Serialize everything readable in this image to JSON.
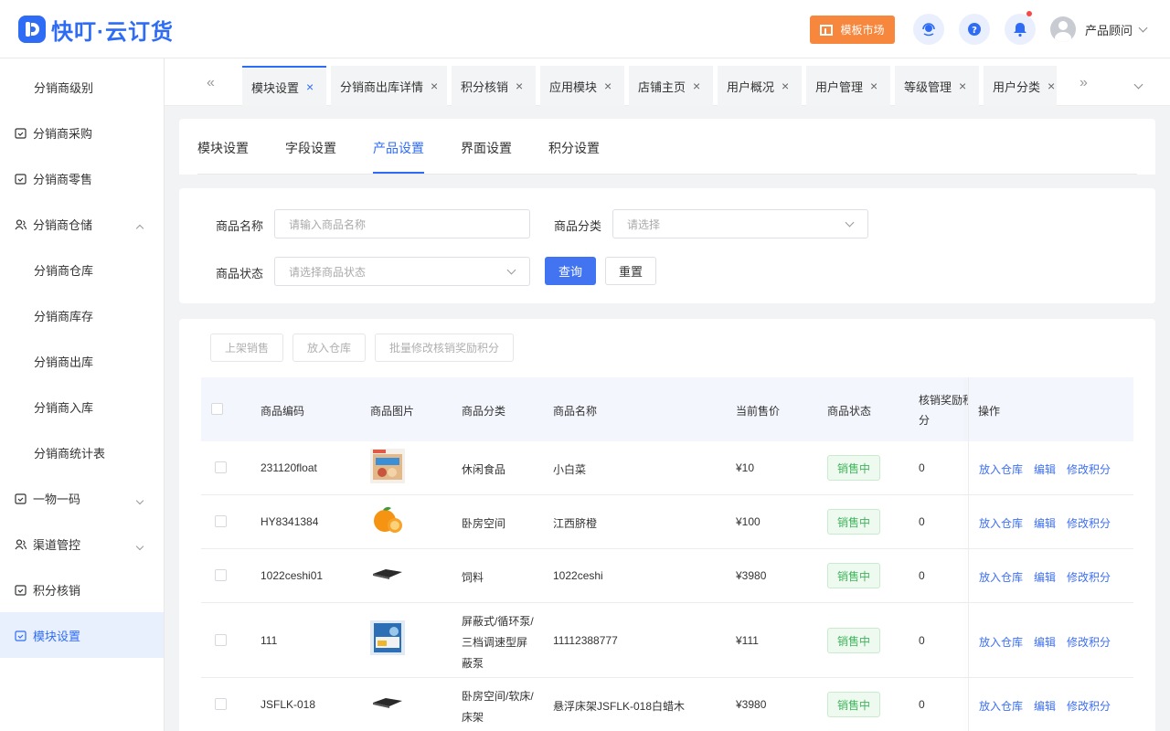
{
  "header": {
    "logo_text": "快叮·云订货",
    "market_label": "模板市场",
    "user_name": "产品顾问"
  },
  "sidebar": {
    "items": [
      {
        "label": "分销商级别",
        "level": "sub"
      },
      {
        "label": "分销商采购",
        "level": "top",
        "icon": "calendar-icon"
      },
      {
        "label": "分销商零售",
        "level": "top",
        "icon": "calendar-icon"
      },
      {
        "label": "分销商仓储",
        "level": "top",
        "icon": "users-icon",
        "expanded": true
      },
      {
        "label": "分销商仓库",
        "level": "sub"
      },
      {
        "label": "分销商库存",
        "level": "sub"
      },
      {
        "label": "分销商出库",
        "level": "sub"
      },
      {
        "label": "分销商入库",
        "level": "sub"
      },
      {
        "label": "分销商统计表",
        "level": "sub"
      },
      {
        "label": "一物一码",
        "level": "top",
        "icon": "calendar-icon",
        "collapsible": true
      },
      {
        "label": "渠道管控",
        "level": "top",
        "icon": "users-icon",
        "collapsible": true
      },
      {
        "label": "积分核销",
        "level": "top",
        "icon": "calendar-icon"
      },
      {
        "label": "模块设置",
        "level": "top",
        "icon": "calendar-icon",
        "active": true
      }
    ]
  },
  "tabs": {
    "prev_symbol": "«",
    "next_symbol": "»",
    "items": [
      {
        "label": "模块设置",
        "active": true
      },
      {
        "label": "分销商出库详情"
      },
      {
        "label": "积分核销"
      },
      {
        "label": "应用模块"
      },
      {
        "label": "店铺主页"
      },
      {
        "label": "用户概况"
      },
      {
        "label": "用户管理"
      },
      {
        "label": "等级管理"
      },
      {
        "label": "用户分类"
      }
    ],
    "close_symbol": "×"
  },
  "subtabs": [
    {
      "label": "模块设置"
    },
    {
      "label": "字段设置"
    },
    {
      "label": "产品设置",
      "active": true
    },
    {
      "label": "界面设置"
    },
    {
      "label": "积分设置"
    }
  ],
  "filters": {
    "name_label": "商品名称",
    "name_placeholder": "请输入商品名称",
    "category_label": "商品分类",
    "category_placeholder": "请选择",
    "status_label": "商品状态",
    "status_placeholder": "请选择商品状态",
    "query_label": "查询",
    "reset_label": "重置"
  },
  "actions": {
    "on_sale": "上架销售",
    "to_warehouse": "放入仓库",
    "batch_points": "批量修改核销奖励积分"
  },
  "table": {
    "headers": [
      "商品编码",
      "商品图片",
      "商品分类",
      "商品名称",
      "当前售价",
      "商品状态",
      "核销奖励积分",
      "操作"
    ],
    "header_points_line1": "核销奖励积",
    "header_points_line2": "分",
    "rows": [
      {
        "code": "231120float",
        "image": "snack-bag-image",
        "category": [
          "休闲食品"
        ],
        "name": "小白菜",
        "price": "¥10",
        "status": "销售中",
        "points": "0"
      },
      {
        "code": "HY8341384",
        "image": "orange-image",
        "category": [
          "卧房空间"
        ],
        "name": "江西脐橙",
        "price": "¥100",
        "status": "销售中",
        "points": "0"
      },
      {
        "code": "1022ceshi01",
        "image": "black-board-image",
        "category": [
          "饲料"
        ],
        "name": "1022ceshi",
        "price": "¥3980",
        "status": "销售中",
        "points": "0"
      },
      {
        "code": "111",
        "image": "product-box-image",
        "category": [
          "屏蔽式/循环泵/",
          "三档调速型屏",
          "蔽泵"
        ],
        "name": "11112388777",
        "price": "¥111",
        "status": "销售中",
        "points": "0"
      },
      {
        "code": "JSFLK-018",
        "image": "black-board-image",
        "category": [
          "卧房空间/软床/",
          "床架"
        ],
        "name": "悬浮床架JSFLK-018白蜡木",
        "price": "¥3980",
        "status": "销售中",
        "points": "0"
      }
    ],
    "ops": {
      "to_warehouse": "放入仓库",
      "edit": "编辑",
      "edit_points": "修改积分"
    }
  },
  "colors": {
    "primary": "#2f6cf6",
    "market": "#f7873d",
    "status_green": "#3fb55b"
  }
}
